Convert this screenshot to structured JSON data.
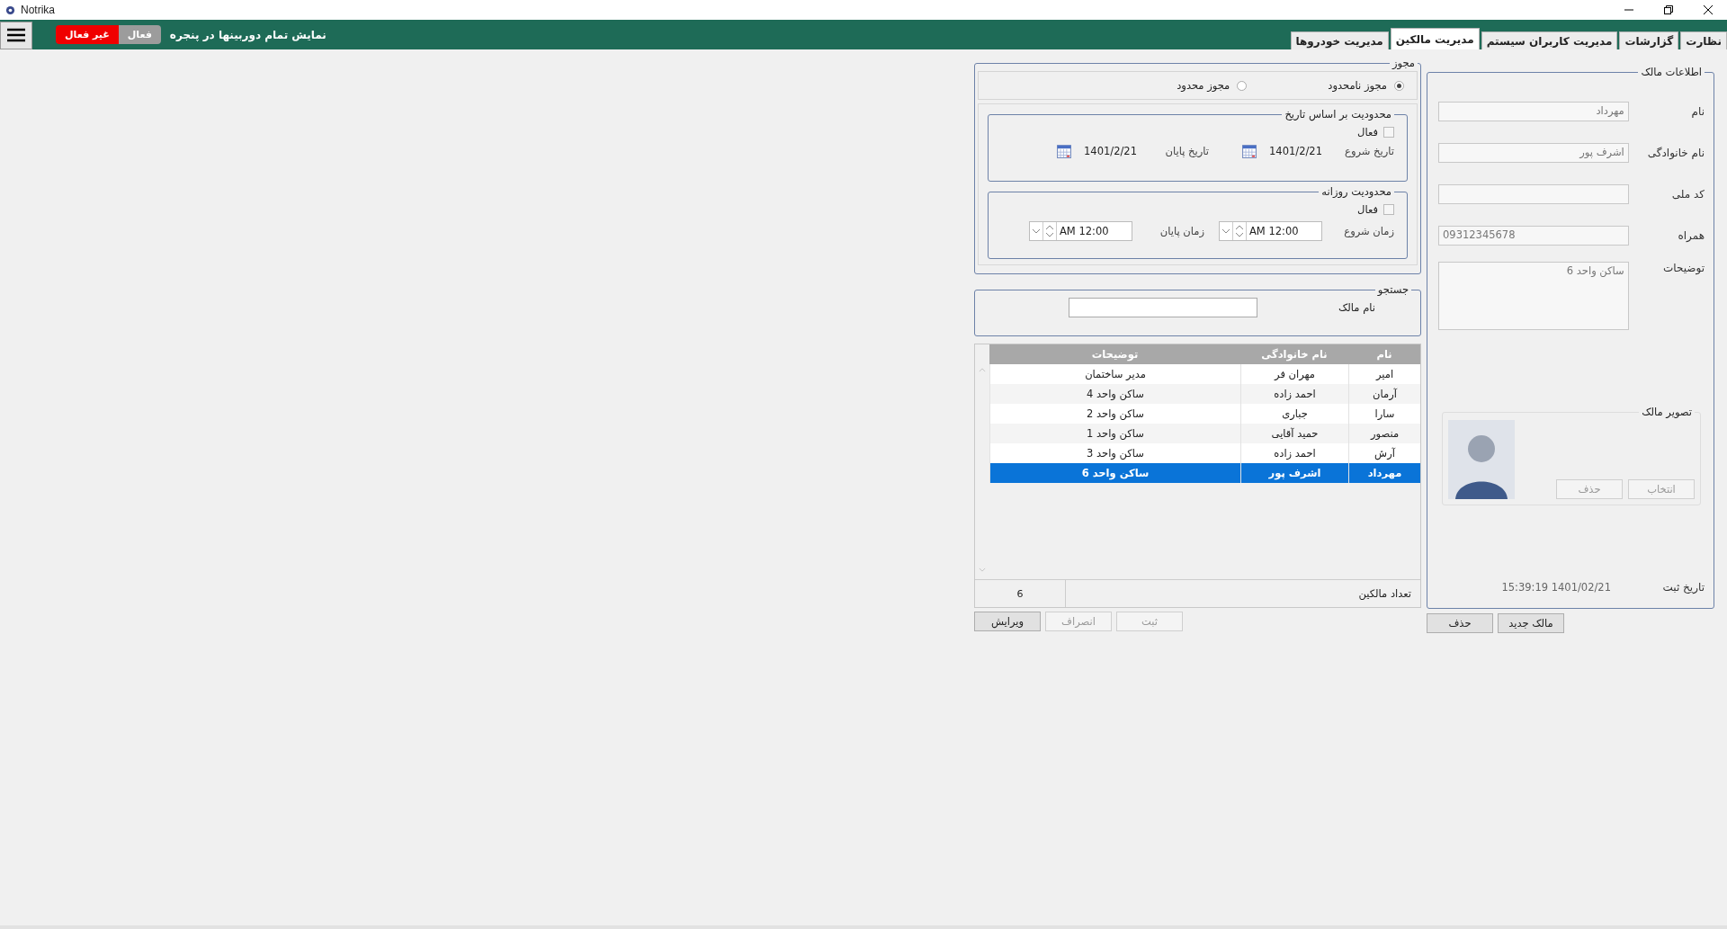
{
  "window": {
    "title": "Notrika"
  },
  "toolbar": {
    "camera_label": "نمایش تمام دوربینها در پنجره",
    "camera_options": [
      {
        "label": "فعال",
        "selected": false
      },
      {
        "label": "غیر فعال",
        "selected": true
      }
    ]
  },
  "tabs": [
    {
      "label": "نظارت",
      "selected": false
    },
    {
      "label": "گزارشات",
      "selected": false
    },
    {
      "label": "مدیریت کاربران سیستم",
      "selected": false
    },
    {
      "label": "مدیریت مالکین",
      "selected": true
    },
    {
      "label": "مدیریت خودروها",
      "selected": false
    }
  ],
  "owner": {
    "title": "اطلاعات مالک",
    "fields": [
      {
        "label": "نام",
        "value": "مهرداد",
        "ltr": false
      },
      {
        "label": "نام خانوادگی",
        "value": "اشرف پور",
        "ltr": false
      },
      {
        "label": "کد ملی"
      },
      {
        "label": "همراه",
        "value": "09312345678",
        "ltr": true
      }
    ],
    "notes": {
      "label": "توضیحات",
      "value": "ساکن واحد 6"
    },
    "photo": {
      "title": "تصویر مالک",
      "buttons": [
        {
          "label": "انتخاب",
          "disabled": true
        },
        {
          "label": "حذف",
          "disabled": true
        }
      ]
    },
    "registered": {
      "label": "تاریخ ثبت",
      "value": "15:39:19 1401/02/21"
    }
  },
  "owner_actions": [
    {
      "label": "مالک جدید",
      "disabled": false
    },
    {
      "label": "حذف",
      "disabled": false
    }
  ],
  "permission": {
    "title": "مجوز",
    "options": [
      {
        "label": "مجوز نامحدود",
        "selected": true
      },
      {
        "label": "مجوز محدود",
        "selected": false
      }
    ],
    "date_limit": {
      "title": "محدودیت بر اساس تاریخ",
      "active_label": "فعال",
      "checked": false,
      "start_label": "تاریخ شروع",
      "start": "1401/2/21",
      "end_label": "تاریخ پایان",
      "end": "1401/2/21"
    },
    "daily_limit": {
      "title": "محدودیت روزانه",
      "active_label": "فعال",
      "checked": false,
      "start_label": "زمان شروع",
      "start": "AM 12:00",
      "end_label": "زمان پایان",
      "end": "AM 12:00"
    }
  },
  "search": {
    "title": "جستجو",
    "label": "نام مالک"
  },
  "table": {
    "columns": [
      "نام",
      "نام خانوادگی",
      "توضیحات"
    ],
    "rows": [
      {
        "cells": [
          "امیر",
          "مهران فر",
          "مدیر ساختمان"
        ],
        "selected": false
      },
      {
        "cells": [
          "آرمان",
          "احمد زاده",
          "ساکن واحد 4"
        ],
        "selected": false
      },
      {
        "cells": [
          "سارا",
          "جباری",
          "ساکن واحد 2"
        ],
        "selected": false
      },
      {
        "cells": [
          "منصور",
          "حمید آقایی",
          "ساکن واحد 1"
        ],
        "selected": false
      },
      {
        "cells": [
          "آرش",
          "احمد زاده",
          "ساکن واحد 3"
        ],
        "selected": false
      },
      {
        "cells": [
          "مهرداد",
          "اشرف پور",
          "ساکن واحد 6"
        ],
        "selected": true
      }
    ]
  },
  "count": {
    "label": "تعداد مالکین",
    "value": "6"
  },
  "actions": [
    {
      "label": "ثبت",
      "disabled": true
    },
    {
      "label": "انصراف",
      "disabled": true
    },
    {
      "label": "ویرایش",
      "disabled": false
    }
  ]
}
